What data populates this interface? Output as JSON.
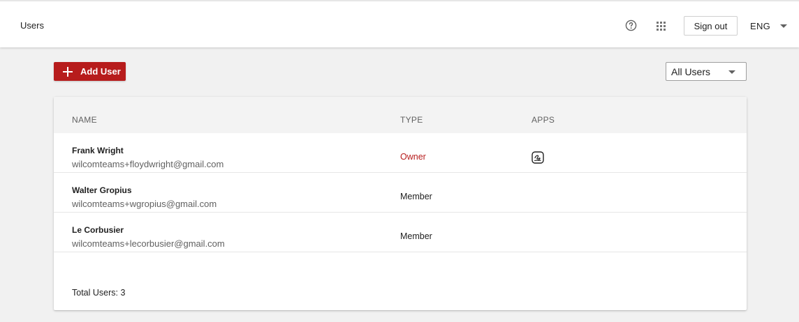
{
  "header": {
    "title": "Users",
    "help_icon": "help-circle-icon",
    "apps_icon": "apps-grid-icon",
    "signout_label": "Sign out",
    "language": "ENG"
  },
  "toolbar": {
    "add_user_label": "Add User",
    "filter_value": "All Users"
  },
  "colors": {
    "accent": "#b71c1c",
    "owner_text": "#b71c1c"
  },
  "table": {
    "columns": [
      "NAME",
      "TYPE",
      "APPS"
    ],
    "rows": [
      {
        "name": "Frank Wright",
        "email": "wilcomteams+floydwright@gmail.com",
        "type": "Owner",
        "app_icon": "signature-app-icon"
      },
      {
        "name": "Walter Gropius",
        "email": "wilcomteams+wgropius@gmail.com",
        "type": "Member"
      },
      {
        "name": "Le Corbusier",
        "email": "wilcomteams+lecorbusier@gmail.com",
        "type": "Member"
      }
    ],
    "total_label": "Total Users: 3"
  }
}
